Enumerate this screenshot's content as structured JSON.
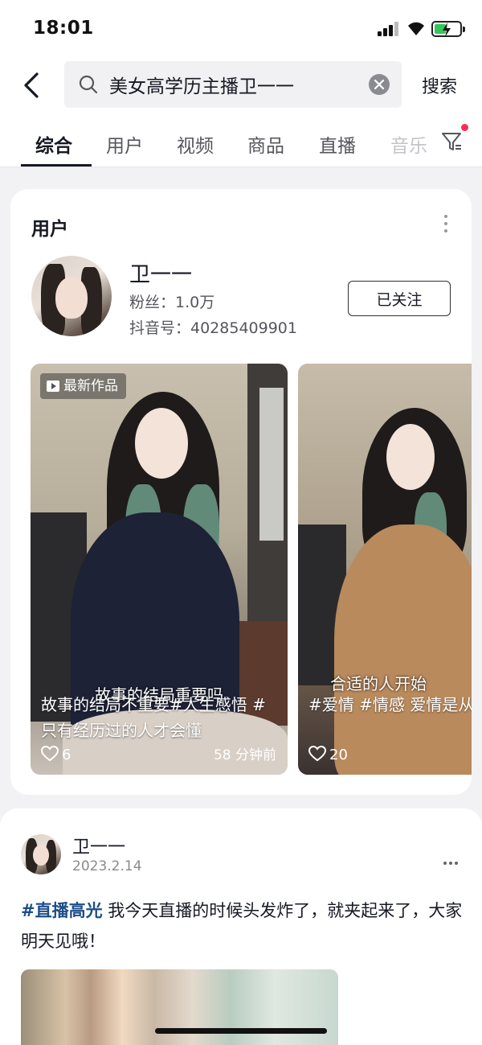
{
  "status_bar": {
    "time": "18:01",
    "battery_fraction": 0.35,
    "battery_color": "#34c759"
  },
  "search": {
    "query": "美女高学历主播卫一一",
    "button_label": "搜索"
  },
  "tabs": [
    {
      "label": "综合",
      "active": true
    },
    {
      "label": "用户"
    },
    {
      "label": "视频"
    },
    {
      "label": "商品"
    },
    {
      "label": "直播"
    },
    {
      "label": "音乐"
    }
  ],
  "filter": {
    "icon": "filter-icon",
    "has_notification": true,
    "dot_color": "#fe2c55"
  },
  "user_section": {
    "title": "用户",
    "user": {
      "name": "卫一一",
      "fans": "粉丝：1.0万",
      "douyin_id": "抖音号：40285409901",
      "follow_label": "已关注"
    },
    "works": [
      {
        "badge": "最新作品",
        "video_subtitle": "故事的结局重要吗",
        "caption": "故事的结局不重要#人生感悟 #只有经历过的人才会懂",
        "likes": "6",
        "time_ago": "58 分钟前"
      },
      {
        "video_subtitle": "合适的人开始",
        "caption": "#爱情 #情感 爱情是从合适开始 己开始的",
        "likes": "20"
      }
    ]
  },
  "post": {
    "author": "卫一一",
    "date": "2023.2.14",
    "hashtag": "#直播高光",
    "text": " 我今天直播的时候头发炸了，就夹起来了，大家明天见哦！",
    "hashtag_color": "#1d4e89"
  }
}
